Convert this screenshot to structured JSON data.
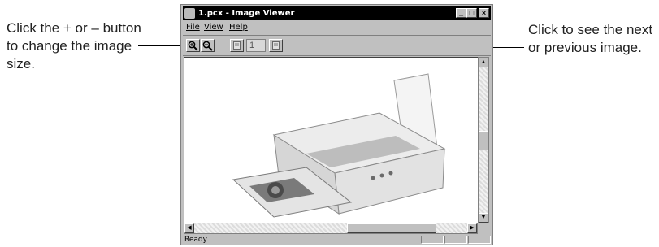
{
  "callouts": {
    "left": "Click the + or – button to change the image size.",
    "right": "Click to see the next or previous image."
  },
  "window": {
    "title": "1.pcx - Image Viewer",
    "menu": {
      "file": "File",
      "view": "View",
      "help": "Help"
    },
    "page_value": "1",
    "status": "Ready"
  },
  "icons": {
    "zoom_in": "zoom-in-icon",
    "zoom_out": "zoom-out-icon",
    "previous": "previous-page-icon",
    "next": "next-page-icon"
  }
}
